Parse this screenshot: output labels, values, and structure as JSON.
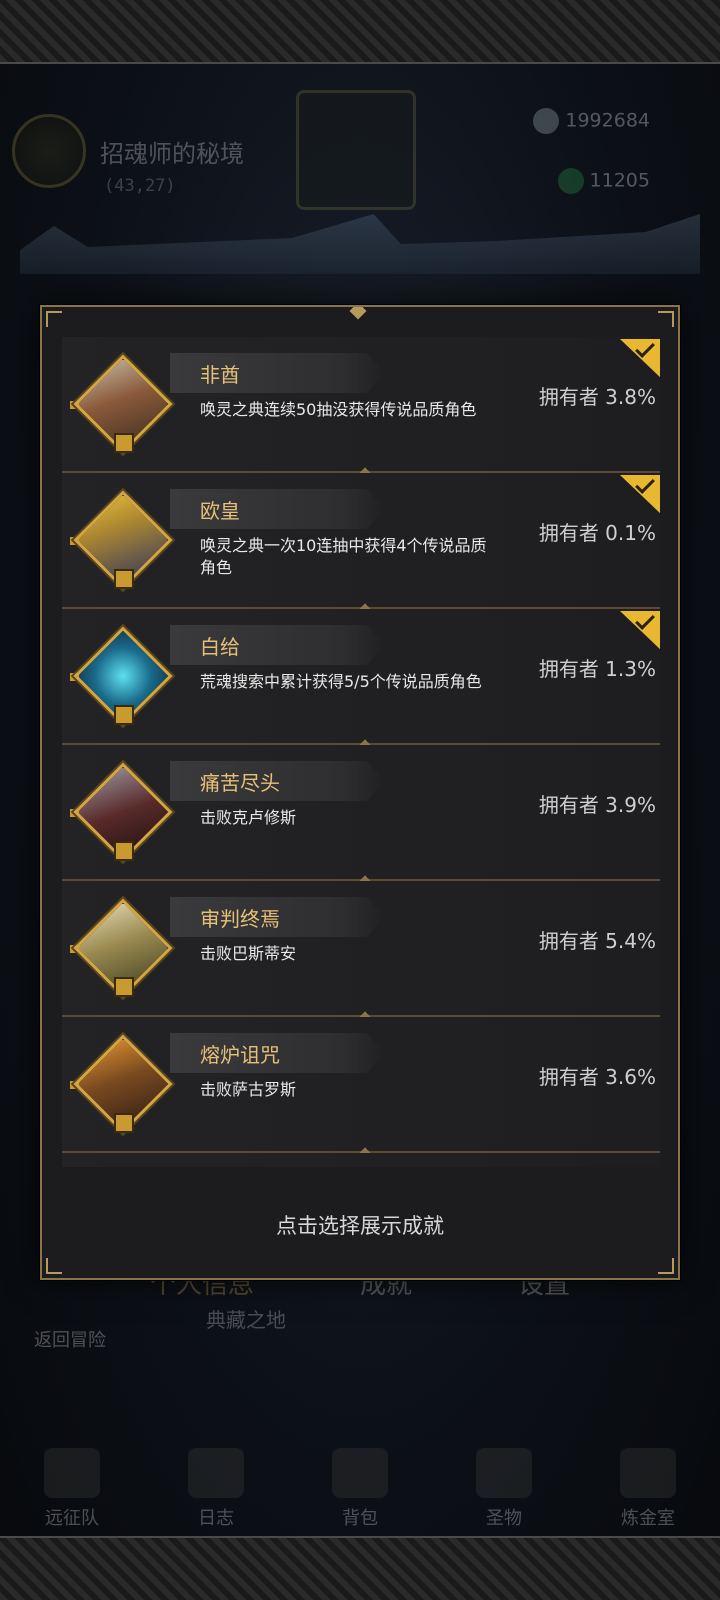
{
  "background": {
    "location_title": "招魂师的秘境",
    "location_coord": "(43,27)",
    "resource_1": "1992684",
    "resource_2": "11205",
    "tabs": [
      "个人信息",
      "成就",
      "设置"
    ],
    "sub_label": "典藏之地",
    "back_label": "返回冒险",
    "nav": [
      "远征队",
      "日志",
      "背包",
      "圣物",
      "炼金室"
    ]
  },
  "achievements": [
    {
      "title": "非酋",
      "description": "唤灵之典连续50抽没获得传说品质角色",
      "owners": "拥有者 3.8%",
      "selected": true,
      "badge_icon": "feathered-warrior-icon"
    },
    {
      "title": "欧皇",
      "description": "唤灵之典一次10连抽中获得4个传说品质角色",
      "owners": "拥有者 0.1%",
      "selected": true,
      "badge_icon": "crowned-king-icon"
    },
    {
      "title": "白给",
      "description": "荒魂搜索中累计获得5/5个传说品质角色",
      "owners": "拥有者 1.3%",
      "selected": true,
      "badge_icon": "blue-flame-icon"
    },
    {
      "title": "痛苦尽头",
      "description": "击败克卢修斯",
      "owners": "拥有者 3.9%",
      "selected": false,
      "badge_icon": "armored-knight-icon"
    },
    {
      "title": "审判终焉",
      "description": "击败巴斯蒂安",
      "owners": "拥有者 5.4%",
      "selected": false,
      "badge_icon": "white-bishop-icon"
    },
    {
      "title": "熔炉诅咒",
      "description": "击败萨古罗斯",
      "owners": "拥有者 3.6%",
      "selected": false,
      "badge_icon": "forge-beast-icon"
    }
  ],
  "footer": {
    "hint": "点击选择展示成就"
  }
}
